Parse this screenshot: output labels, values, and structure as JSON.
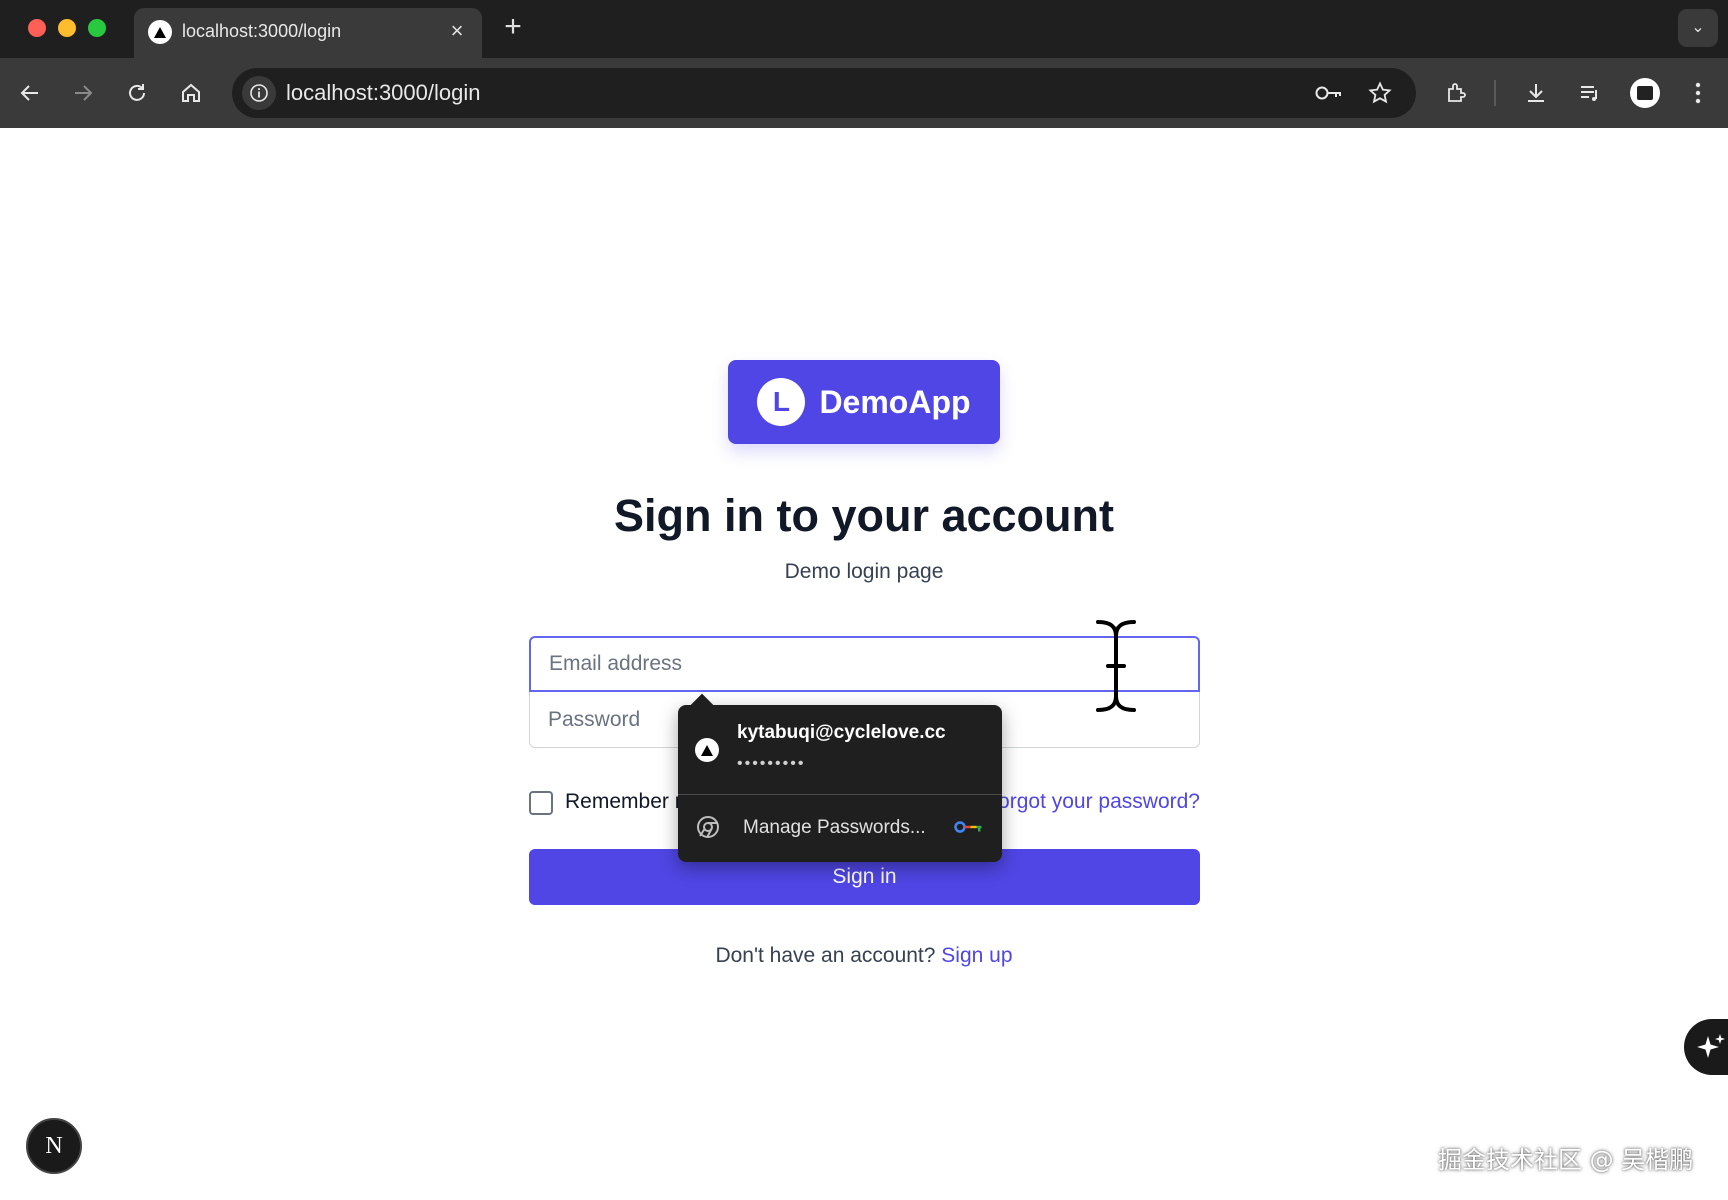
{
  "browser": {
    "tab_title": "localhost:3000/login",
    "url": "localhost:3000/login"
  },
  "app": {
    "logo_letter": "L",
    "logo_name": "DemoApp",
    "heading": "Sign in to your account",
    "subheading": "Demo login page"
  },
  "form": {
    "email_placeholder": "Email address",
    "email_value": "",
    "password_placeholder": "Password",
    "password_value": "",
    "remember_label": "Remember me",
    "forgot_link": "Forgot your password?",
    "submit_label": "Sign in",
    "signup_prompt": "Don't have an account?",
    "signup_link": "Sign up"
  },
  "password_popup": {
    "username": "kytabuqi@cyclelove.cc",
    "masked_password": "•••••••••",
    "manage_label": "Manage Passwords..."
  },
  "nextjs_badge": "N",
  "watermark": "掘金技术社区 @ 吴楷鹏",
  "colors": {
    "accent": "#4f46e5",
    "focus_ring": "#6366f1",
    "chrome_dark": "#1f1f1f",
    "chrome_mid": "#3a3a3a"
  },
  "icons": [
    "back-icon",
    "forward-icon",
    "reload-icon",
    "home-icon",
    "site-info-icon",
    "password-key-icon",
    "bookmark-star-icon",
    "extensions-icon",
    "download-icon",
    "reading-list-icon",
    "profile-icon",
    "more-menu-icon",
    "chrome-icon",
    "sparkle-icon"
  ]
}
